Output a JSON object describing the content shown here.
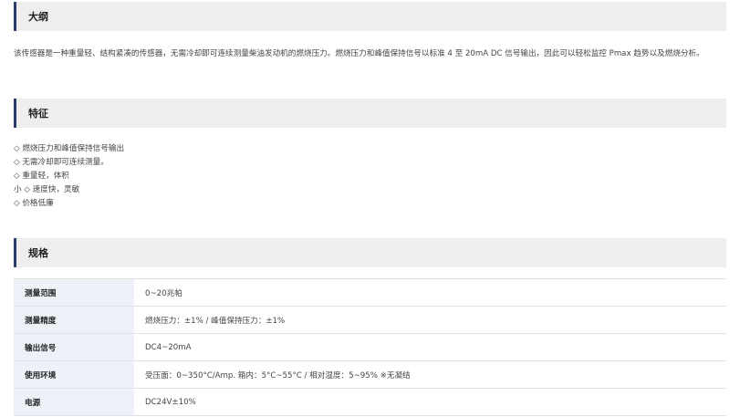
{
  "outline": {
    "title": "大纲",
    "description": "该传感器是一种重量轻、结构紧凑的传感器，无需冷却即可连续测量柴油发动机的燃烧压力。燃烧压力和峰值保持信号以标准 4 至 20mA DC 信号输出，因此可以轻松监控 Pmax 趋势以及燃烧分析。"
  },
  "features": {
    "title": "特征",
    "items": [
      "◇ 燃烧压力和峰值保持信号输出",
      "◇ 无需冷却即可连续测量。",
      "◇ 重量轻，体积",
      "小 ◇ 速度快，灵敏",
      "◇ 价格低廉"
    ]
  },
  "specs": {
    "title": "规格",
    "rows": [
      {
        "label": "测量范围",
        "value": "0~20兆帕"
      },
      {
        "label": "测量精度",
        "value": "燃烧压力：±1% / 峰值保持压力：±1%"
      },
      {
        "label": "输出信号",
        "value": "DC4~20mA"
      },
      {
        "label": "使用环境",
        "value": "受压面：0~350°C/Amp. 箱内：5°C~55°C / 相对湿度：5~95% ※无凝结"
      },
      {
        "label": "电源",
        "value": "DC24V±10%"
      }
    ]
  }
}
